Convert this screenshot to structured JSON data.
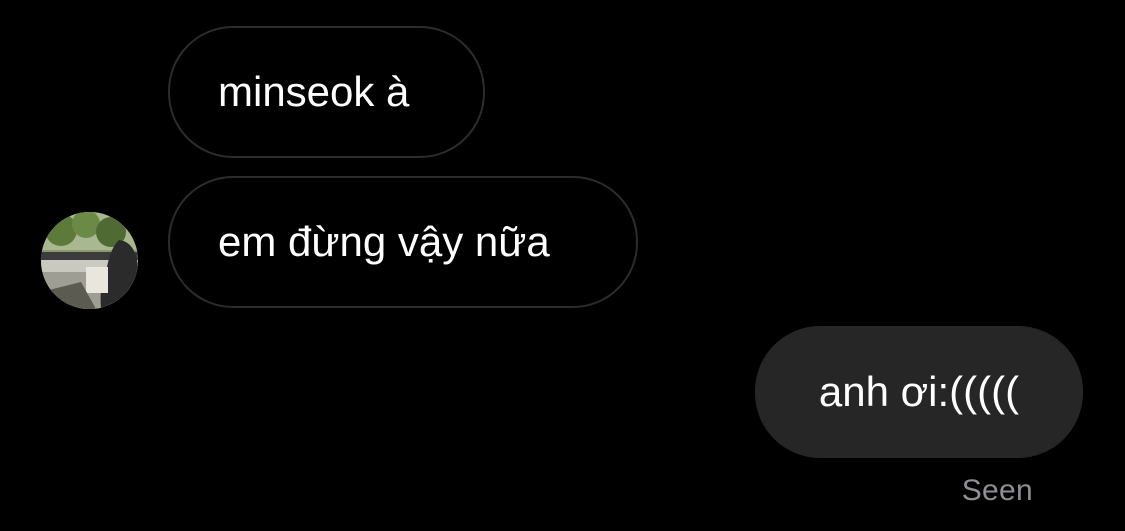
{
  "conversation": {
    "messages": [
      {
        "direction": "incoming",
        "text": "minseok à"
      },
      {
        "direction": "incoming",
        "text": "em đừng vậy nữa"
      },
      {
        "direction": "outgoing",
        "text": "anh ơi:((((("
      }
    ],
    "avatar_icon": "profile-photo",
    "read_receipt": "Seen"
  },
  "colors": {
    "background": "#000000",
    "incoming_border": "#2c2c2e",
    "outgoing_fill": "#262626",
    "text": "#ffffff",
    "receipt_text": "#8e8e93"
  }
}
